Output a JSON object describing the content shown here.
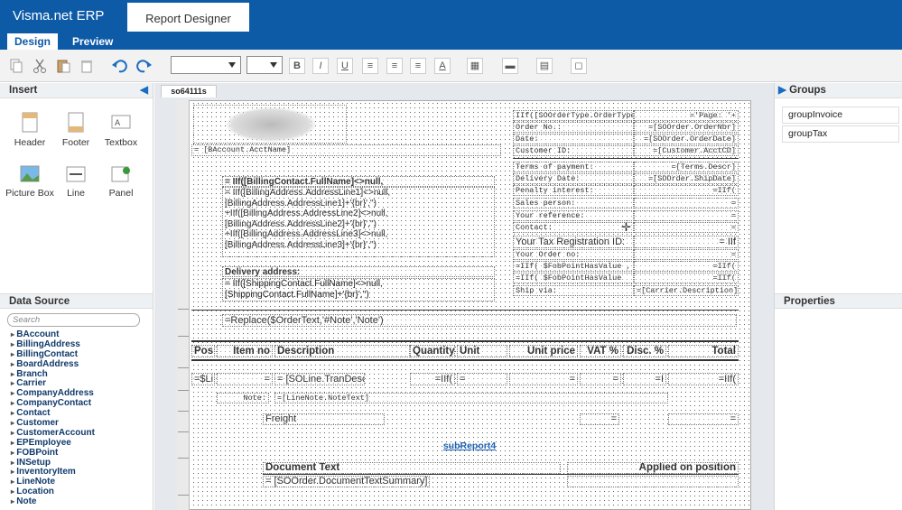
{
  "app": {
    "brand": "Visma.net ERP",
    "tab": "Report Designer"
  },
  "modes": {
    "design": "Design",
    "preview": "Preview"
  },
  "toolbar": {
    "bold": "B",
    "italic": "I",
    "underline": "U"
  },
  "insert": {
    "title": "Insert",
    "items": [
      "Header",
      "Footer",
      "Textbox",
      "Picture Box",
      "Line",
      "Panel"
    ]
  },
  "datasource": {
    "title": "Data Source",
    "search_placeholder": "Search",
    "items": [
      "BAccount",
      "BillingAddress",
      "BillingContact",
      "BoardAddress",
      "Branch",
      "Carrier",
      "CompanyAddress",
      "CompanyContact",
      "Contact",
      "Customer",
      "CustomerAccount",
      "EPEmployee",
      "FOBPoint",
      "INSetup",
      "InventoryItem",
      "LineNote",
      "Location",
      "Note"
    ]
  },
  "document": {
    "tab": "so64111s"
  },
  "groups": {
    "title": "Groups",
    "items": [
      "groupInvoice",
      "groupTax"
    ]
  },
  "properties": {
    "title": "Properties"
  },
  "report": {
    "acct": "= [BAccount.AcctName]",
    "billing_lines": [
      "= IIf([BillingContact.FullName]<>null,",
      "= IIf([BillingAddress.AddressLine1]<>null,",
      "[BillingAddress.AddressLine1]+'{br}','')",
      "+IIf([BillingAddress.AddressLine2]<>null,",
      "[BillingAddress.AddressLine2]+'{br}','')",
      "+IIf([BillingAddress.AddressLine3]<>null,",
      "[BillingAddress.AddressLine3]+'{br}','')"
    ],
    "delivery_label": "Delivery address:",
    "shipping_lines": [
      "= IIf([ShippingContact.FullName]<>null,",
      "[ShippingContact.FullName]+'{br}','')"
    ],
    "order_text": "=Replace($OrderText,'#Note','Note')",
    "header_labels": [
      "IIf([SOOrderType.OrderType",
      "Order No.:",
      "Date:",
      "Customer ID:"
    ],
    "header_values": [
      "='Page: '+",
      "=[SOOrder.OrderNbr]",
      "=[SOOrder.OrderDate]",
      "=[Customer.AcctCD]"
    ],
    "info_labels": [
      "Terms of payment:",
      "Delivery Date:",
      "Penalty interest:",
      "Sales person:",
      "Your reference:",
      "Contact:"
    ],
    "info_values": [
      "=[Terms.Descr]",
      "=[SOOrder.ShipDate]",
      "=IIf(",
      "=",
      "=",
      "="
    ],
    "tax_label": "Your Tax Registration ID:",
    "tax_value": "= IIf",
    "order_no_label": "Your Order no:",
    "fob_labels": [
      "=IIf( $FobPointHasValue ,",
      "=IIf( $FobPointHasValue"
    ],
    "fob_values": [
      "=IIf(",
      "=IIf("
    ],
    "ship_via": "Ship via:",
    "carrier": "=[Carrier.Description]",
    "columns": [
      "Pos",
      "Item no",
      "Description",
      "Quantity",
      "Unit",
      "Unit price",
      "VAT %",
      "Disc. %",
      "Total"
    ],
    "detail": {
      "li": "=$Li",
      "tran": "= [SOLine.TranDesc]",
      "iif": "=IIf(",
      "eq": "=",
      "i": "=I"
    },
    "note_label": "Note:",
    "note_value": "=[LineNote.NoteText]",
    "freight": "Freight",
    "subreport": "subReport4",
    "doc_text": "Document Text",
    "applied": "Applied on position",
    "summary": "= [SOOrder.DocumentTextSummary]"
  }
}
